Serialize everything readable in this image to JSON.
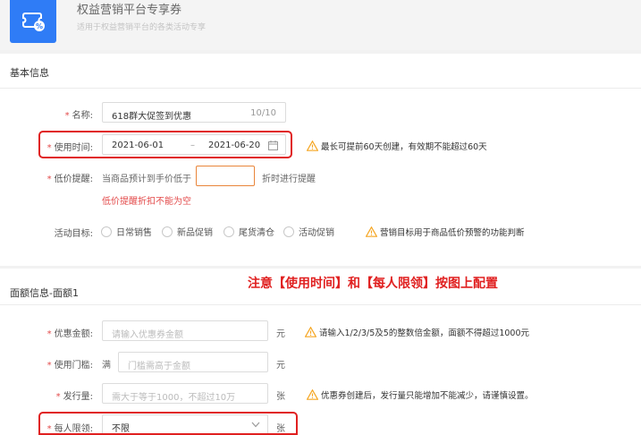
{
  "header": {
    "title": "权益营销平台专享券",
    "subtitle": "适用于权益营销平台的各类活动专享"
  },
  "basic": {
    "section_title": "基本信息",
    "name_label": "名称:",
    "name_value": "618群大促签到优惠",
    "name_count": "10/10",
    "time_label": "使用时间:",
    "start_date": "2021-06-01",
    "date_sep": "–",
    "end_date": "2021-06-20",
    "time_hint": "最长可提前60天创建，有效期不能超过60天",
    "price_label": "低价提醒:",
    "price_prefix": "当商品预计到手价低于",
    "price_suffix": "折时进行提醒",
    "price_error": "低价提醒折扣不能为空",
    "goal_label": "活动目标:",
    "goal_options": [
      "日常销售",
      "新品促销",
      "尾货清仓",
      "活动促销"
    ],
    "goal_hint": "营销目标用于商品低价预警的功能判断"
  },
  "amount": {
    "section_title": "面额信息-面额1",
    "notice": "注意【使用时间】和【每人限领】按图上配置",
    "amount_label": "优惠金额:",
    "amount_placeholder": "请输入优惠券金额",
    "amount_unit": "元",
    "amount_hint": "请输入1/2/3/5及5的整数倍金额，面额不得超过1000元",
    "threshold_label": "使用门槛:",
    "threshold_prefix": "满",
    "threshold_placeholder": "门槛需高于金额",
    "threshold_unit": "元",
    "issue_label": "发行量:",
    "issue_placeholder": "需大于等于1000，不超过10万",
    "issue_unit": "张",
    "issue_hint": "优惠券创建后，发行量只能增加不能减少，请谨慎设置。",
    "limit_label": "每人限领:",
    "limit_value": "不限",
    "limit_unit": "张"
  },
  "colors": {
    "brand": "#2f7cf6",
    "error": "#e34b4b",
    "highlight": "#e02020",
    "warning": "#f5a623"
  }
}
